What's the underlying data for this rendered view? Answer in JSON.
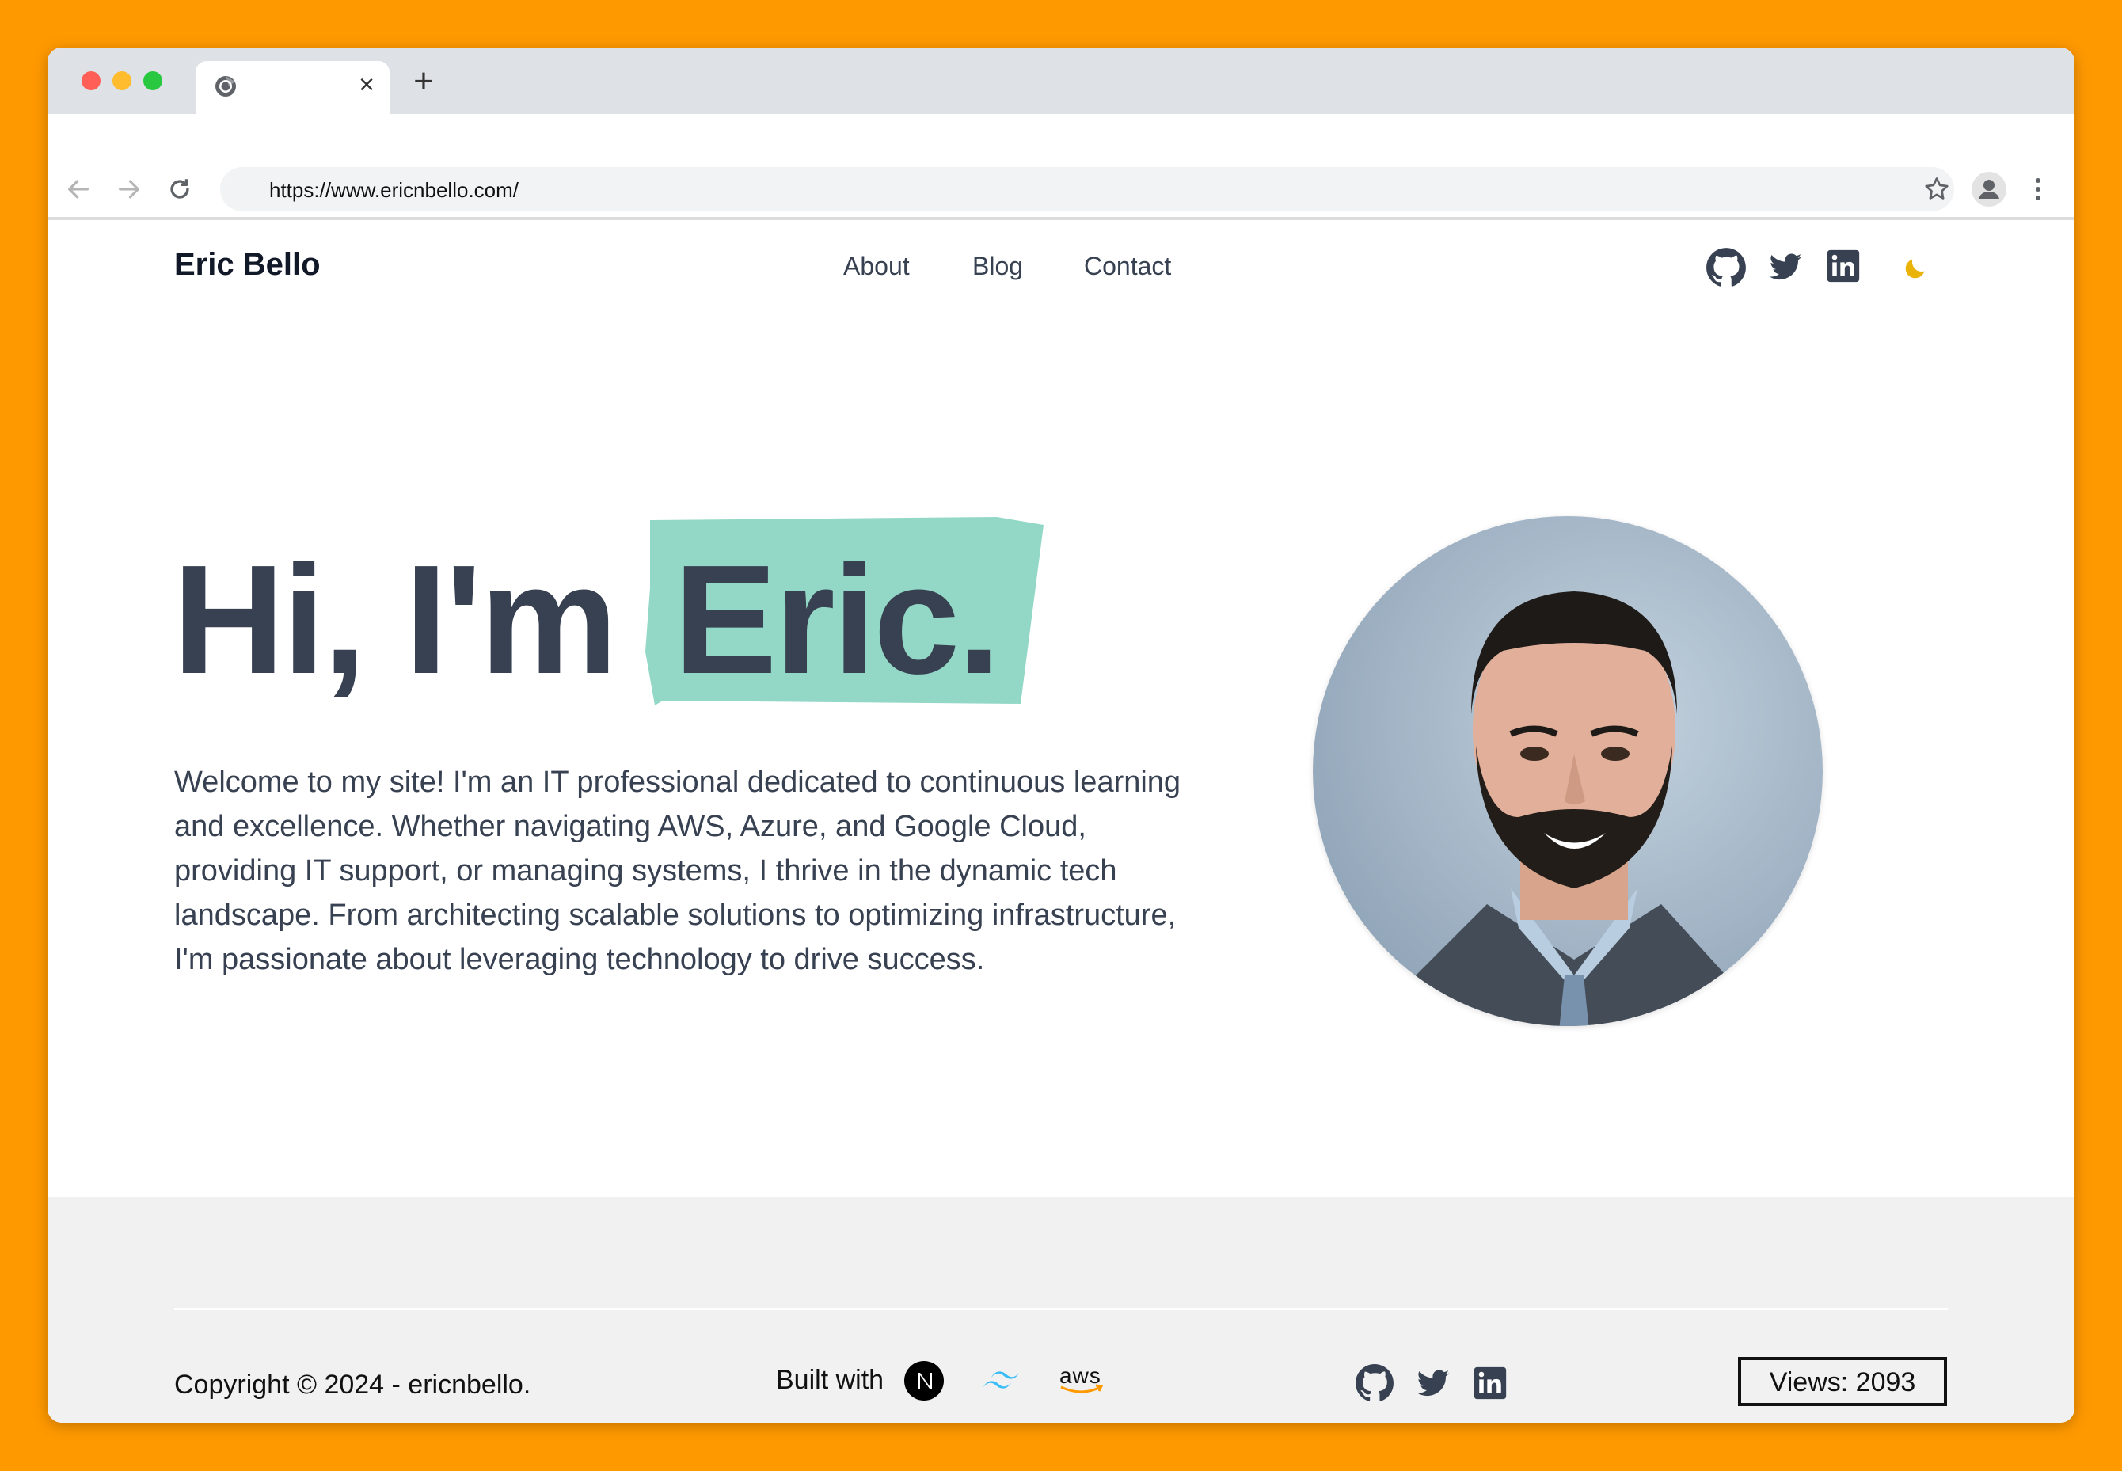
{
  "browser": {
    "tab_close": "×",
    "new_tab": "+",
    "url": "https://www.ericnbello.com/"
  },
  "site": {
    "brand": "Eric Bello",
    "nav": [
      "About",
      "Blog",
      "Contact"
    ],
    "social_icons": [
      "github-icon",
      "twitter-icon",
      "linkedin-icon"
    ],
    "theme_icon": "moon-icon"
  },
  "hero": {
    "greeting": "Hi, I'm",
    "name": "Eric.",
    "text": "Welcome to my site! I'm an IT professional dedicated to continuous learning and excellence. Whether navigating AWS, Azure, and Google Cloud, providing IT support, or managing systems, I thrive in the dynamic tech landscape. From architecting scalable solutions to optimizing infrastructure, I'm passionate about leveraging technology to drive success."
  },
  "footer": {
    "copyright": "Copyright © 2024 - ericnbello.",
    "built_with": "Built with",
    "tech_icons": [
      "nextjs-icon",
      "tailwind-icon",
      "aws-icon"
    ],
    "aws_label": "aws",
    "views": "Views: 2093"
  },
  "colors": {
    "page_bg": "#ff9900",
    "highlight": "#93d8c6",
    "text": "#374151",
    "moon": "#eab308"
  }
}
